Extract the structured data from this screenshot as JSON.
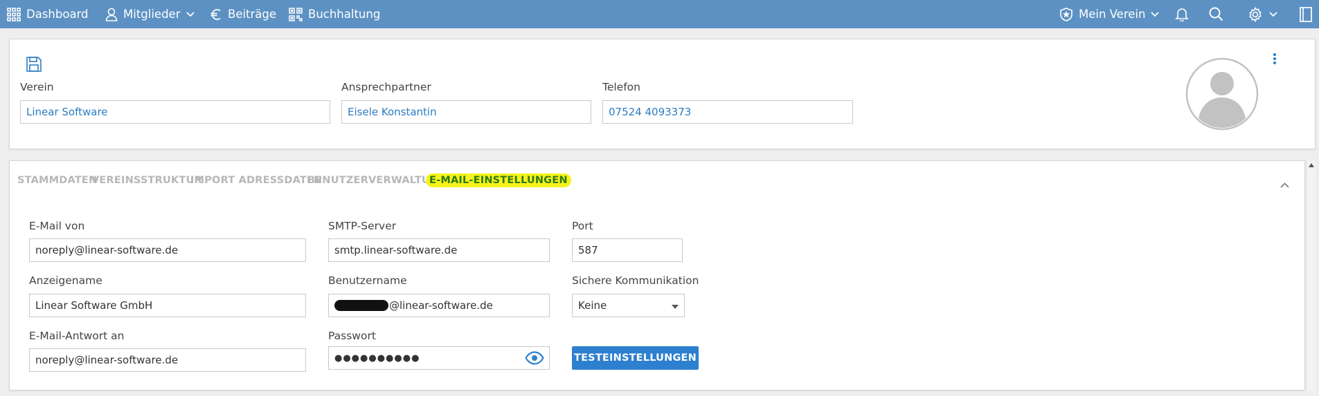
{
  "nav": {
    "dashboard": "Dashboard",
    "mitglieder": "Mitglieder",
    "beitraege": "Beiträge",
    "buchhaltung": "Buchhaltung",
    "mein_verein": "Mein Verein"
  },
  "header_card": {
    "verein_label": "Verein",
    "verein_value": "Linear Software",
    "ansprechpartner_label": "Ansprechpartner",
    "ansprechpartner_value": "Eisele Konstantin",
    "telefon_label": "Telefon",
    "telefon_value": "07524 4093373"
  },
  "tabs": [
    {
      "label": "STAMMDATEN"
    },
    {
      "label": "VEREINSSTRUKTUR"
    },
    {
      "label": "IMPORT ADRESSDATEN"
    },
    {
      "label": "BENUTZERVERWALTUNG"
    },
    {
      "label": "E-MAIL-EINSTELLUNGEN",
      "active": true
    }
  ],
  "email_settings": {
    "email_von_label": "E-Mail von",
    "email_von_value": "noreply@linear-software.de",
    "smtp_label": "SMTP-Server",
    "smtp_value": "smtp.linear-software.de",
    "port_label": "Port",
    "port_value": "587",
    "anzeigename_label": "Anzeigename",
    "anzeigename_value": "Linear Software GmbH",
    "benutzername_label": "Benutzername",
    "benutzername_value": "@linear-software.de",
    "sichere_label": "Sichere Kommunikation",
    "sichere_value": "Keine",
    "antwort_label": "E-Mail-Antwort an",
    "antwort_value": "noreply@linear-software.de",
    "passwort_label": "Passwort",
    "passwort_value": "●●●●●●●●●●",
    "test_button": "TESTEINSTELLUNGEN"
  },
  "colors": {
    "topbar": "#5d91c3",
    "link_blue": "#2b7cc2",
    "button_blue": "#2d7fcf",
    "highlight": "#f6f21b",
    "active_tab_text": "#2e7a14"
  }
}
